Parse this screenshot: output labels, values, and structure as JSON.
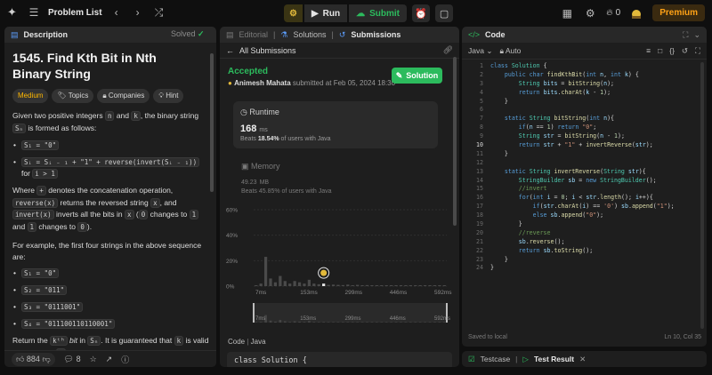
{
  "topbar": {
    "problem_list": "Problem List",
    "run": "Run",
    "submit": "Submit",
    "fire_count": "0",
    "premium": "Premium"
  },
  "desc": {
    "tab": "Description",
    "title": "1545. Find Kth Bit in Nth Binary String",
    "solved": "Solved",
    "tags": [
      "Medium",
      "Topics",
      "Companies",
      "Hint"
    ],
    "p1": [
      "Given two positive integers ",
      "n",
      " and ",
      "k",
      ", the binary string ",
      "Sₙ",
      " is formed as follows:"
    ],
    "rule1": "S₁ = \"0\"",
    "rule2a": "Sᵢ = Sᵢ ₋ ₁ + \"1\" + reverse(invert(Sᵢ ₋ ₁))",
    "rule2b": " for ",
    "rule2c": "i > 1",
    "p2": [
      "Where ",
      "+",
      " denotes the concatenation operation, ",
      "reverse(x)",
      " returns the reversed string ",
      "x",
      ", and ",
      "invert(x)",
      " inverts all the bits in ",
      "x",
      " (",
      "0",
      " changes to ",
      "1",
      " and ",
      "1",
      " changes to ",
      "0",
      ")."
    ],
    "p3": "For example, the first four strings in the above sequence are:",
    "examples": [
      "S₁ = \"0\"",
      "S₂ = \"011\"",
      "S₃ = \"0111001\"",
      "S₄ = \"011100110110001\""
    ],
    "p4": [
      "Return the ",
      "kᵗʰ",
      " bit",
      " in ",
      "Sₙ",
      ". It is guaranteed that ",
      "k",
      " is valid for the given ",
      "n",
      "."
    ],
    "likes": "884",
    "comments": "8"
  },
  "sub": {
    "tabs": [
      "Editorial",
      "Solutions",
      "Submissions"
    ],
    "all_submissions": "All Submissions",
    "status": "Accepted",
    "author": "Animesh Mahata",
    "submitted": "submitted at Feb 05, 2024 18:30",
    "solution_btn": "Solution",
    "runtime_label": "Runtime",
    "runtime_value": "168",
    "runtime_unit": "ms",
    "runtime_beats_pre": "Beats ",
    "runtime_beats": "18.54%",
    "runtime_beats_post": " of users with Java",
    "memory_label": "Memory",
    "memory_value": "49.23",
    "memory_unit": "MB",
    "memory_beats": "Beats 45.85% of users with Java",
    "code_label": "Code",
    "code_lang": "Java",
    "code_snip": "class Solution {"
  },
  "chart_data": {
    "type": "bar",
    "yticks": [
      "60%",
      "40%",
      "20%",
      "0%"
    ],
    "ylim": [
      0,
      60
    ],
    "xticks": [
      "7ms",
      "153ms",
      "299ms",
      "446ms",
      "592ms"
    ],
    "values": [
      0.5,
      2,
      23,
      6,
      3,
      8,
      4,
      2,
      4,
      3,
      2,
      5,
      2,
      1.5,
      2,
      1,
      1.2,
      1,
      0.8,
      1.2,
      0.7,
      1,
      0.6,
      0.8,
      0.5,
      0.7,
      0.4,
      0.5,
      0.4,
      0.4,
      0.3,
      0.3,
      0.3,
      0.3,
      0.2,
      0.3,
      0.2,
      0.2,
      0.2,
      0.2
    ],
    "highlight_index": 14,
    "grid": true
  },
  "code": {
    "tab": "Code",
    "lang": "Java",
    "mode": "Auto",
    "saved": "Saved to local",
    "cursor": "Ln 10, Col 35",
    "current_line": 10,
    "lines": [
      [
        [
          "kw",
          "class "
        ],
        [
          "ty",
          "Solution "
        ],
        [
          "",
          "{"
        ]
      ],
      [
        [
          "",
          "    "
        ],
        [
          "kw",
          "public char "
        ],
        [
          "fn",
          "findKthBit"
        ],
        [
          "",
          "("
        ],
        [
          "kw",
          "int "
        ],
        [
          "vr",
          "n"
        ],
        [
          "",
          ", "
        ],
        [
          "kw",
          "int "
        ],
        [
          "vr",
          "k"
        ],
        [
          "",
          ") {"
        ]
      ],
      [
        [
          "",
          "        "
        ],
        [
          "ty",
          "String "
        ],
        [
          "vr",
          "bits "
        ],
        [
          "",
          "= "
        ],
        [
          "fn",
          "bitString"
        ],
        [
          "",
          "("
        ],
        [
          "vr",
          "n"
        ],
        [
          "",
          ");"
        ]
      ],
      [
        [
          "",
          "        "
        ],
        [
          "kw",
          "return "
        ],
        [
          "vr",
          "bits"
        ],
        [
          "",
          "."
        ],
        [
          "fn",
          "charAt"
        ],
        [
          "",
          "("
        ],
        [
          "vr",
          "k "
        ],
        [
          "",
          "- "
        ],
        [
          "nu",
          "1"
        ],
        [
          "",
          ");"
        ]
      ],
      [
        [
          "",
          "    }"
        ]
      ],
      [
        [
          "",
          ""
        ]
      ],
      [
        [
          "",
          "    "
        ],
        [
          "kw",
          "static "
        ],
        [
          "ty",
          "String "
        ],
        [
          "fn",
          "bitString"
        ],
        [
          "",
          "("
        ],
        [
          "kw",
          "int "
        ],
        [
          "vr",
          "n"
        ],
        [
          "",
          "){"
        ]
      ],
      [
        [
          "",
          "        "
        ],
        [
          "kw",
          "if"
        ],
        [
          "",
          "("
        ],
        [
          "vr",
          "n "
        ],
        [
          "",
          "== "
        ],
        [
          "nu",
          "1"
        ],
        [
          "",
          ") "
        ],
        [
          "kw",
          "return "
        ],
        [
          "st",
          "\"0\""
        ],
        [
          "",
          ";"
        ]
      ],
      [
        [
          "",
          "        "
        ],
        [
          "ty",
          "String "
        ],
        [
          "vr",
          "str "
        ],
        [
          "",
          "= "
        ],
        [
          "fn",
          "bitString"
        ],
        [
          "",
          "("
        ],
        [
          "vr",
          "n "
        ],
        [
          "",
          "- "
        ],
        [
          "nu",
          "1"
        ],
        [
          "",
          ");"
        ]
      ],
      [
        [
          "",
          "        "
        ],
        [
          "kw",
          "return "
        ],
        [
          "vr",
          "str "
        ],
        [
          "",
          "+ "
        ],
        [
          "st",
          "\"1\" "
        ],
        [
          "",
          "+ "
        ],
        [
          "fn",
          "invertReverse"
        ],
        [
          "",
          "("
        ],
        [
          "vr",
          "str"
        ],
        [
          "",
          ");"
        ]
      ],
      [
        [
          "",
          "    }"
        ]
      ],
      [
        [
          "",
          ""
        ]
      ],
      [
        [
          "",
          "    "
        ],
        [
          "kw",
          "static "
        ],
        [
          "ty",
          "String "
        ],
        [
          "fn",
          "invertReverse"
        ],
        [
          "",
          "("
        ],
        [
          "ty",
          "String "
        ],
        [
          "vr",
          "str"
        ],
        [
          "",
          "){"
        ]
      ],
      [
        [
          "",
          "        "
        ],
        [
          "ty",
          "StringBuilder "
        ],
        [
          "vr",
          "sb "
        ],
        [
          "",
          "= "
        ],
        [
          "kw",
          "new "
        ],
        [
          "ty",
          "StringBuilder"
        ],
        [
          "",
          "();"
        ]
      ],
      [
        [
          "",
          "        "
        ],
        [
          "cm",
          "//invert"
        ]
      ],
      [
        [
          "",
          "        "
        ],
        [
          "kw",
          "for"
        ],
        [
          "",
          "("
        ],
        [
          "kw",
          "int "
        ],
        [
          "vr",
          "i "
        ],
        [
          "",
          "= "
        ],
        [
          "nu",
          "0"
        ],
        [
          "",
          "; "
        ],
        [
          "vr",
          "i "
        ],
        [
          "",
          "< "
        ],
        [
          "vr",
          "str"
        ],
        [
          "",
          "."
        ],
        [
          "fn",
          "length"
        ],
        [
          "",
          "(); "
        ],
        [
          "vr",
          "i"
        ],
        [
          "",
          "++){"
        ]
      ],
      [
        [
          "",
          "            "
        ],
        [
          "kw",
          "if"
        ],
        [
          "",
          "("
        ],
        [
          "vr",
          "str"
        ],
        [
          "",
          "."
        ],
        [
          "fn",
          "charAt"
        ],
        [
          "",
          "("
        ],
        [
          "vr",
          "i"
        ],
        [
          "",
          ") == "
        ],
        [
          "st",
          "'0'"
        ],
        [
          "",
          ") "
        ],
        [
          "vr",
          "sb"
        ],
        [
          "",
          "."
        ],
        [
          "fn",
          "append"
        ],
        [
          "",
          "("
        ],
        [
          "st",
          "\"1\""
        ],
        [
          "",
          ");"
        ]
      ],
      [
        [
          "",
          "            "
        ],
        [
          "kw",
          "else "
        ],
        [
          "vr",
          "sb"
        ],
        [
          "",
          "."
        ],
        [
          "fn",
          "append"
        ],
        [
          "",
          "("
        ],
        [
          "st",
          "\"0\""
        ],
        [
          "",
          ");"
        ]
      ],
      [
        [
          "",
          "        }"
        ]
      ],
      [
        [
          "",
          "        "
        ],
        [
          "cm",
          "//reverse"
        ]
      ],
      [
        [
          "",
          "        "
        ],
        [
          "vr",
          "sb"
        ],
        [
          "",
          "."
        ],
        [
          "fn",
          "reverse"
        ],
        [
          "",
          "();"
        ]
      ],
      [
        [
          "",
          "        "
        ],
        [
          "kw",
          "return "
        ],
        [
          "vr",
          "sb"
        ],
        [
          "",
          "."
        ],
        [
          "fn",
          "toString"
        ],
        [
          "",
          "();"
        ]
      ],
      [
        [
          "",
          "    }"
        ]
      ],
      [
        [
          "",
          "}"
        ]
      ]
    ]
  },
  "test": {
    "testcase": "Testcase",
    "result": "Test Result"
  },
  "colors": {
    "accent_green": "#2cbb5d",
    "medium": "#ffb800",
    "premium": "#ffa116",
    "bar": "#4a4a4a",
    "bar_highlight": "#e6e6e6"
  }
}
